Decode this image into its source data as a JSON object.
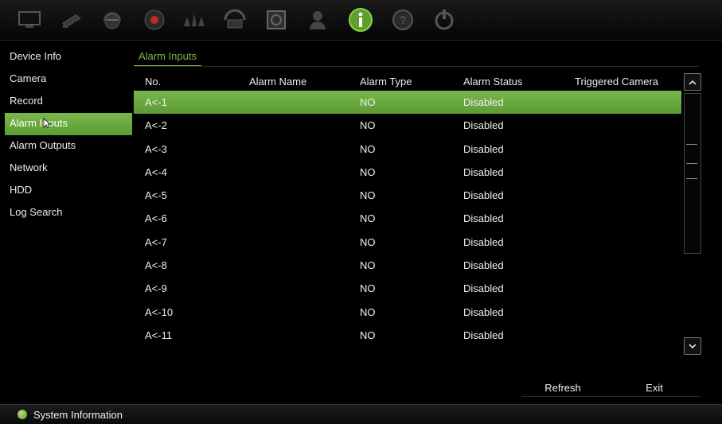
{
  "toolbar": {
    "icons": [
      "monitor-icon",
      "camera-icon",
      "dome-camera-icon",
      "record-icon",
      "alarm-icon",
      "network-icon",
      "hdd-icon",
      "user-icon",
      "info-icon",
      "help-icon",
      "power-icon"
    ],
    "active_icon": "info-icon"
  },
  "sidebar": {
    "items": [
      {
        "label": "Device Info"
      },
      {
        "label": "Camera"
      },
      {
        "label": "Record"
      },
      {
        "label": "Alarm Inputs",
        "active": true
      },
      {
        "label": "Alarm Outputs"
      },
      {
        "label": "Network"
      },
      {
        "label": "HDD"
      },
      {
        "label": "Log Search"
      }
    ]
  },
  "main": {
    "tab_label": "Alarm Inputs",
    "columns": [
      "No.",
      "Alarm Name",
      "Alarm Type",
      "Alarm Status",
      "Triggered Camera"
    ],
    "rows": [
      {
        "no": "A<-1",
        "name": "",
        "type": "NO",
        "status": "Disabled",
        "camera": "",
        "selected": true
      },
      {
        "no": "A<-2",
        "name": "",
        "type": "NO",
        "status": "Disabled",
        "camera": ""
      },
      {
        "no": "A<-3",
        "name": "",
        "type": "NO",
        "status": "Disabled",
        "camera": ""
      },
      {
        "no": "A<-4",
        "name": "",
        "type": "NO",
        "status": "Disabled",
        "camera": ""
      },
      {
        "no": "A<-5",
        "name": "",
        "type": "NO",
        "status": "Disabled",
        "camera": ""
      },
      {
        "no": "A<-6",
        "name": "",
        "type": "NO",
        "status": "Disabled",
        "camera": ""
      },
      {
        "no": "A<-7",
        "name": "",
        "type": "NO",
        "status": "Disabled",
        "camera": ""
      },
      {
        "no": "A<-8",
        "name": "",
        "type": "NO",
        "status": "Disabled",
        "camera": ""
      },
      {
        "no": "A<-9",
        "name": "",
        "type": "NO",
        "status": "Disabled",
        "camera": ""
      },
      {
        "no": "A<-10",
        "name": "",
        "type": "NO",
        "status": "Disabled",
        "camera": ""
      },
      {
        "no": "A<-11",
        "name": "",
        "type": "NO",
        "status": "Disabled",
        "camera": ""
      }
    ]
  },
  "buttons": {
    "refresh": "Refresh",
    "exit": "Exit"
  },
  "statusbar": {
    "text": "System Information"
  },
  "colors": {
    "accent": "#7ab84c",
    "background": "#000000",
    "text": "#ececec"
  }
}
